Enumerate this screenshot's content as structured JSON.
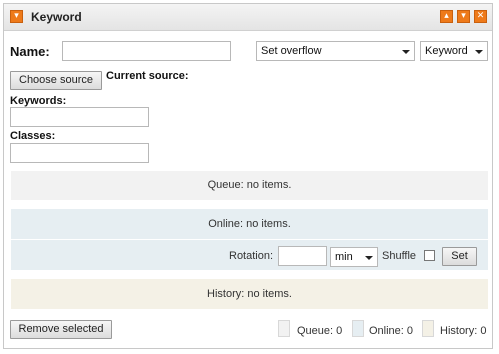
{
  "window": {
    "title": "Keyword",
    "title_icon": "chevron-down-icon",
    "controls": [
      "chevron-up-icon",
      "chevron-down-icon",
      "close-icon"
    ]
  },
  "form": {
    "name_label": "Name:",
    "name_value": "",
    "overflow_select": "Set overflow",
    "type_select": "Keyword",
    "choose_source_label": "Choose source",
    "current_source_label": "Current source:",
    "keywords_label": "Keywords:",
    "keywords_value": "",
    "classes_label": "Classes:",
    "classes_value": ""
  },
  "queue": {
    "text": "Queue: no items."
  },
  "online": {
    "text": "Online: no items.",
    "rotation_label": "Rotation:",
    "rotation_value": "",
    "unit_select": "min",
    "shuffle_label": "Shuffle",
    "shuffle_checked": false,
    "set_label": "Set"
  },
  "history": {
    "text": "History: no items."
  },
  "footer": {
    "remove_label": "Remove selected",
    "legend": [
      {
        "label": "Queue: 0",
        "color": "#f2f2f2"
      },
      {
        "label": "Online: 0",
        "color": "#e6eef2"
      },
      {
        "label": "History: 0",
        "color": "#f4f1e6"
      }
    ]
  },
  "colors": {
    "accent": "#ee7a1a",
    "queue_bg": "#f2f2f2",
    "online_bg": "#e6eef2",
    "history_bg": "#f4f1e6"
  }
}
